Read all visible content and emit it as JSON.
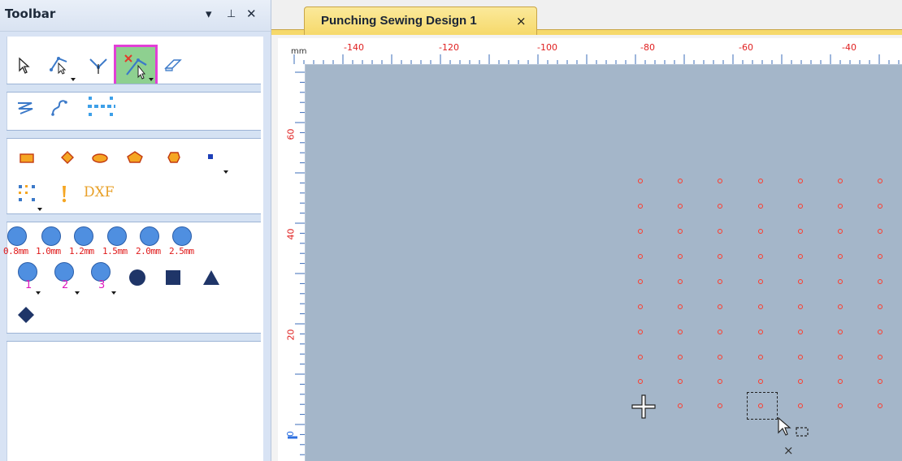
{
  "toolbar": {
    "title": "Toolbar",
    "pin_icon": "pin-icon",
    "dropdown_icon": "dropdown-icon",
    "close_icon": "close-icon",
    "dxf_label": "DXF",
    "punch_sizes": [
      "0.8mm",
      "1.0mm",
      "1.2mm",
      "1.5mm",
      "2.0mm",
      "2.5mm"
    ],
    "numbered_tools": [
      "1",
      "2",
      "3"
    ]
  },
  "document": {
    "tab_title": "Punching Sewing Design 1",
    "tab_close": "×",
    "ruler_unit": "mm",
    "ruler_top_labels": [
      "-140",
      "-120",
      "-100",
      "-80",
      "-60",
      "-40"
    ],
    "ruler_left_labels": [
      "60",
      "40",
      "20",
      "0"
    ]
  },
  "colors": {
    "active_tool_outline": "#e23fd6",
    "active_tool_bg": "#8ed090",
    "tab_yellow": "#f6d96b",
    "canvas": "#a4b6c9",
    "punch_dot": "#ff3a2a",
    "ruler_label": "#e02020"
  }
}
